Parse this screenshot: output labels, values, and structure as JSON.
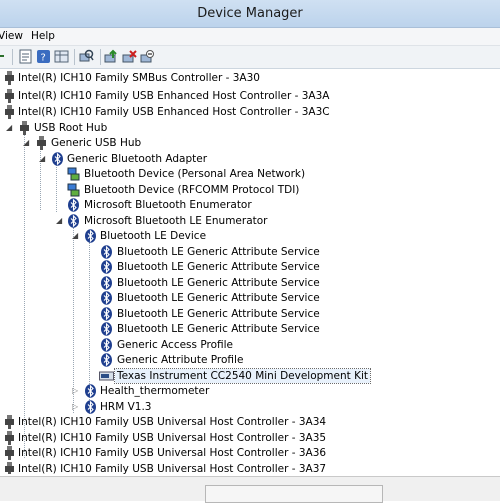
{
  "window": {
    "title": "Device Manager"
  },
  "menu": {
    "items": [
      "View",
      "Help"
    ]
  },
  "toolbar": {
    "buttons": [
      "back-icon",
      "properties-icon",
      "help-icon",
      "scan-hardware-icon",
      "update-driver-icon",
      "uninstall-icon",
      "disable-icon"
    ]
  },
  "tree": {
    "rows": [
      {
        "label": "Intel(R) ICH10 Family SMBus Controller - 3A30",
        "icon": "usb-plug-icon"
      },
      {
        "label": "Intel(R) ICH10 Family USB Enhanced Host Controller - 3A3A",
        "icon": "usb-plug-icon"
      },
      {
        "label": "Intel(R) ICH10 Family USB Enhanced Host Controller - 3A3C",
        "icon": "usb-plug-icon"
      },
      {
        "label": "USB Root Hub",
        "icon": "usb-plug-icon",
        "expanded": true
      },
      {
        "label": "Generic USB Hub",
        "icon": "usb-plug-icon",
        "expanded": true
      },
      {
        "label": "Generic Bluetooth Adapter",
        "icon": "bluetooth-icon",
        "expanded": true
      },
      {
        "label": "Bluetooth Device (Personal Area Network)",
        "icon": "network-device-icon"
      },
      {
        "label": "Bluetooth Device (RFCOMM Protocol TDI)",
        "icon": "network-device-icon"
      },
      {
        "label": "Microsoft Bluetooth Enumerator",
        "icon": "bluetooth-icon"
      },
      {
        "label": "Microsoft Bluetooth LE Enumerator",
        "icon": "bluetooth-icon",
        "expanded": true
      },
      {
        "label": "Bluetooth LE Device",
        "icon": "bluetooth-icon",
        "expanded": true
      },
      {
        "label": "Bluetooth LE Generic Attribute Service",
        "icon": "bluetooth-icon"
      },
      {
        "label": "Bluetooth LE Generic Attribute Service",
        "icon": "bluetooth-icon"
      },
      {
        "label": "Bluetooth LE Generic Attribute Service",
        "icon": "bluetooth-icon"
      },
      {
        "label": "Bluetooth LE Generic Attribute Service",
        "icon": "bluetooth-icon"
      },
      {
        "label": "Bluetooth LE Generic Attribute Service",
        "icon": "bluetooth-icon"
      },
      {
        "label": "Bluetooth LE Generic Attribute Service",
        "icon": "bluetooth-icon"
      },
      {
        "label": "Generic Access Profile",
        "icon": "bluetooth-icon"
      },
      {
        "label": "Generic Attribute Profile",
        "icon": "bluetooth-icon"
      },
      {
        "label": "Texas Instrument CC2540 Mini Development Kit",
        "icon": "device-icon",
        "selected": true
      },
      {
        "label": "Health_thermometer",
        "icon": "bluetooth-icon",
        "expanded": false
      },
      {
        "label": "HRM V1.3",
        "icon": "bluetooth-icon",
        "expanded": false
      },
      {
        "label": "Intel(R) ICH10 Family USB Universal Host Controller - 3A34",
        "icon": "usb-plug-icon"
      },
      {
        "label": "Intel(R) ICH10 Family USB Universal Host Controller - 3A35",
        "icon": "usb-plug-icon"
      },
      {
        "label": "Intel(R) ICH10 Family USB Universal Host Controller - 3A36",
        "icon": "usb-plug-icon"
      },
      {
        "label": "Intel(R) ICH10 Family USB Universal Host Controller - 3A37",
        "icon": "usb-plug-icon"
      }
    ]
  },
  "colors": {
    "titlebar": "#c6d9ef",
    "bluetooth": "#1f3f8f",
    "selection": "#e8f1fb"
  }
}
